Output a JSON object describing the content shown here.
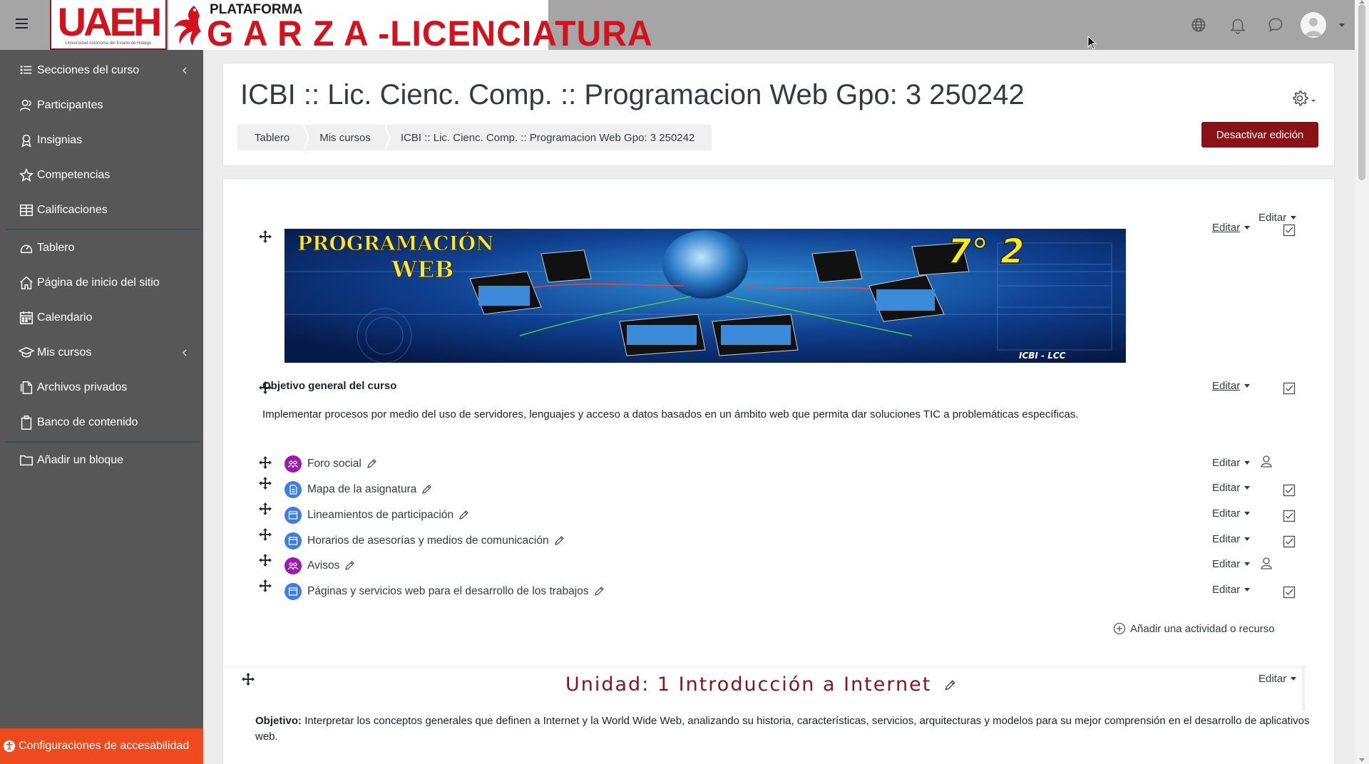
{
  "navbar": {
    "logo_text": "UAEH",
    "logo_subtext": "Universidad Autónoma del Estado de Hidalgo",
    "brand_top": "PLATAFORMA",
    "brand_main": "G A R Z A -LICENCIATURA",
    "icons": [
      "menu-icon",
      "globe-icon",
      "bell-icon",
      "chat-icon",
      "user-avatar"
    ]
  },
  "drawer": {
    "items": [
      {
        "label": "Secciones del curso",
        "icon": "list-icon",
        "chevron": true
      },
      {
        "label": "Participantes",
        "icon": "users-icon"
      },
      {
        "label": "Insignias",
        "icon": "badge-icon"
      },
      {
        "label": "Competencias",
        "icon": "star-icon"
      },
      {
        "label": "Calificaciones",
        "icon": "table-icon"
      },
      {
        "label": "Tablero",
        "icon": "dashboard-icon"
      },
      {
        "label": "Página de inicio del sitio",
        "icon": "home-icon"
      },
      {
        "label": "Calendario",
        "icon": "calendar-icon"
      },
      {
        "label": "Mis cursos",
        "icon": "graduation-cap-icon",
        "chevron": true
      },
      {
        "label": "Archivos privados",
        "icon": "file-icon"
      },
      {
        "label": "Banco de contenido",
        "icon": "clipboard-icon"
      },
      {
        "label": "Añadir un bloque",
        "icon": "folder-plus-icon"
      }
    ],
    "accessibility_label": "Configuraciones de accesabilidad"
  },
  "header": {
    "title": "ICBI :: Lic. Cienc. Comp. :: Programacion Web Gpo: 3 250242",
    "breadcrumb": [
      "Tablero",
      "Mis cursos",
      "ICBI :: Lic. Cienc. Comp. :: Programacion Web Gpo: 3 250242"
    ],
    "edit_off_label": "Desactivar edición"
  },
  "course": {
    "edit_label": "Editar",
    "banner": {
      "line1": "PROGRAMACIÓN",
      "line2": "WEB",
      "term": "7° 2",
      "footer": "ICBI - LCC"
    },
    "section_title": "Objetivo general del curso",
    "section_description": "Implementar procesos por medio del uso de servidores, lenguajes y acceso a datos basados en un ámbito web que permita dar soluciones TIC a problemáticas específicas.",
    "activities": [
      {
        "label": "Foro social",
        "type": "forum",
        "access": "user"
      },
      {
        "label": "Mapa de la asignatura",
        "type": "page",
        "access": "check"
      },
      {
        "label": "Lineamientos de participación",
        "type": "page",
        "access": "check"
      },
      {
        "label": "Horarios de asesorías y medios de comunicación",
        "type": "page",
        "access": "check"
      },
      {
        "label": "Avisos",
        "type": "forum",
        "access": "user"
      },
      {
        "label": "Páginas y servicios web para el desarrollo de los trabajos",
        "type": "page",
        "access": "check"
      }
    ],
    "add_activity_label": "Añadir una actividad o recurso",
    "unit": {
      "title": "Unidad: 1 Introducción a Internet",
      "objective_label": "Objetivo:",
      "objective_text": "Interpretar los conceptos generales que definen a Internet y la World Wide Web, analizando su historia, características, servicios, arquitecturas y modelos para su mejor comprensión en el desarrollo de aplicativos web."
    }
  },
  "colors": {
    "navbar_bg": "#a5a5a5",
    "drawer_bg": "#575757",
    "accent_red": "#8a1217",
    "brand_red": "#d4121e",
    "accessibility_orange": "#ee4a1d",
    "forum_purple": "#9b1ab1",
    "page_blue": "#3f7ee0"
  }
}
